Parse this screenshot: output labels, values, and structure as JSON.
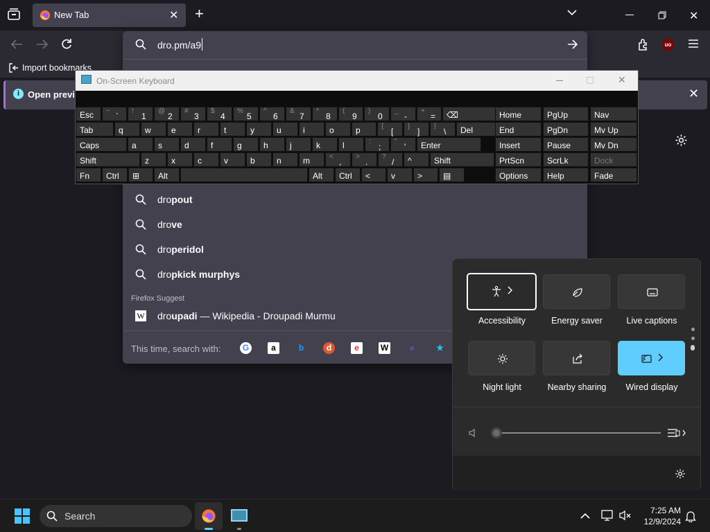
{
  "browser": {
    "tab_title": "New Tab",
    "url_value": "dro.pm/a9",
    "import_bookmarks": "Import bookmarks",
    "notification_text": "Open previo"
  },
  "suggestions": [
    {
      "prefix": "dro",
      "bold": "pout"
    },
    {
      "prefix": "dro",
      "bold": "ve"
    },
    {
      "prefix": "dro",
      "bold": "peridol"
    },
    {
      "prefix": "dro",
      "bold": "pkick murphys"
    }
  ],
  "firefox_suggest": {
    "header": "Firefox Suggest",
    "prefix": "dro",
    "bold": "upadi",
    "rest": " — Wikipedia - Droupadi Murmu"
  },
  "search_with_label": "This time, search with:",
  "search_engines": [
    "google-icon",
    "amazon-icon",
    "bing-icon",
    "duckduckgo-icon",
    "ebay-icon",
    "wikipedia-icon",
    "search-shortcut-icon",
    "bookmarks-star-icon"
  ],
  "osk": {
    "title": "On-Screen Keyboard",
    "rows": [
      [
        {
          "m": "Esc"
        },
        {
          "s": "~",
          "m": "`"
        },
        {
          "s": "!",
          "m": "1"
        },
        {
          "s": "@",
          "m": "2"
        },
        {
          "s": "#",
          "m": "3"
        },
        {
          "s": "$",
          "m": "4"
        },
        {
          "s": "%",
          "m": "5"
        },
        {
          "s": "^",
          "m": "6"
        },
        {
          "s": "&",
          "m": "7"
        },
        {
          "s": "*",
          "m": "8"
        },
        {
          "s": "(",
          "m": "9"
        },
        {
          "s": ")",
          "m": "0"
        },
        {
          "s": "_",
          "m": "-"
        },
        {
          "s": "+",
          "m": "="
        },
        {
          "m": "⌫"
        }
      ],
      [
        {
          "m": "Tab"
        },
        {
          "m": "q"
        },
        {
          "m": "w"
        },
        {
          "m": "e"
        },
        {
          "m": "r"
        },
        {
          "m": "t"
        },
        {
          "m": "y"
        },
        {
          "m": "u"
        },
        {
          "m": "i"
        },
        {
          "m": "o"
        },
        {
          "m": "p"
        },
        {
          "s": "{",
          "m": "["
        },
        {
          "s": "}",
          "m": "]"
        },
        {
          "s": "|",
          "m": "\\"
        },
        {
          "m": "Del"
        }
      ],
      [
        {
          "m": "Caps"
        },
        {
          "m": "a"
        },
        {
          "m": "s"
        },
        {
          "m": "d"
        },
        {
          "m": "f"
        },
        {
          "m": "g"
        },
        {
          "m": "h"
        },
        {
          "m": "j"
        },
        {
          "m": "k"
        },
        {
          "m": "l"
        },
        {
          "s": ":",
          "m": ";"
        },
        {
          "s": "\"",
          "m": "'"
        },
        {
          "m": "Enter"
        }
      ],
      [
        {
          "m": "Shift"
        },
        {
          "m": "z"
        },
        {
          "m": "x"
        },
        {
          "m": "c"
        },
        {
          "m": "v"
        },
        {
          "m": "b"
        },
        {
          "m": "n"
        },
        {
          "m": "m"
        },
        {
          "s": "<",
          "m": ","
        },
        {
          "s": ">",
          "m": "."
        },
        {
          "s": "?",
          "m": "/"
        },
        {
          "m": "^"
        },
        {
          "m": "Shift"
        }
      ],
      [
        {
          "m": "Fn"
        },
        {
          "m": "Ctrl"
        },
        {
          "m": "⊞"
        },
        {
          "m": "Alt"
        },
        {
          "m": ""
        },
        {
          "m": "Alt"
        },
        {
          "m": "Ctrl"
        },
        {
          "m": "<"
        },
        {
          "m": "v"
        },
        {
          "m": ">"
        },
        {
          "m": "▤"
        }
      ]
    ],
    "right_keys": [
      [
        "Home",
        "PgUp",
        "Nav"
      ],
      [
        "End",
        "PgDn",
        "Mv Up"
      ],
      [
        "Insert",
        "Pause",
        "Mv Dn"
      ],
      [
        "PrtScn",
        "ScrLk",
        "Dock"
      ],
      [
        "Options",
        "Help",
        "Fade"
      ]
    ]
  },
  "quick_settings": {
    "tiles": [
      {
        "label": "Accessibility",
        "icon": "accessibility-icon",
        "state": "focused"
      },
      {
        "label": "Energy saver",
        "icon": "energy-saver-icon",
        "state": "off"
      },
      {
        "label": "Live captions",
        "icon": "live-captions-icon",
        "state": "off"
      },
      {
        "label": "Night light",
        "icon": "night-light-icon",
        "state": "off"
      },
      {
        "label": "Nearby sharing",
        "icon": "nearby-sharing-icon",
        "state": "off"
      },
      {
        "label": "Wired display",
        "icon": "wired-display-icon",
        "state": "on"
      }
    ],
    "volume": 0
  },
  "taskbar": {
    "search_label": "Search",
    "time": "7:25 AM",
    "date": "12/9/2024"
  },
  "colors": {
    "accent": "#60cdff",
    "urlbar": "#42414d",
    "tab_active": "#42414d"
  }
}
